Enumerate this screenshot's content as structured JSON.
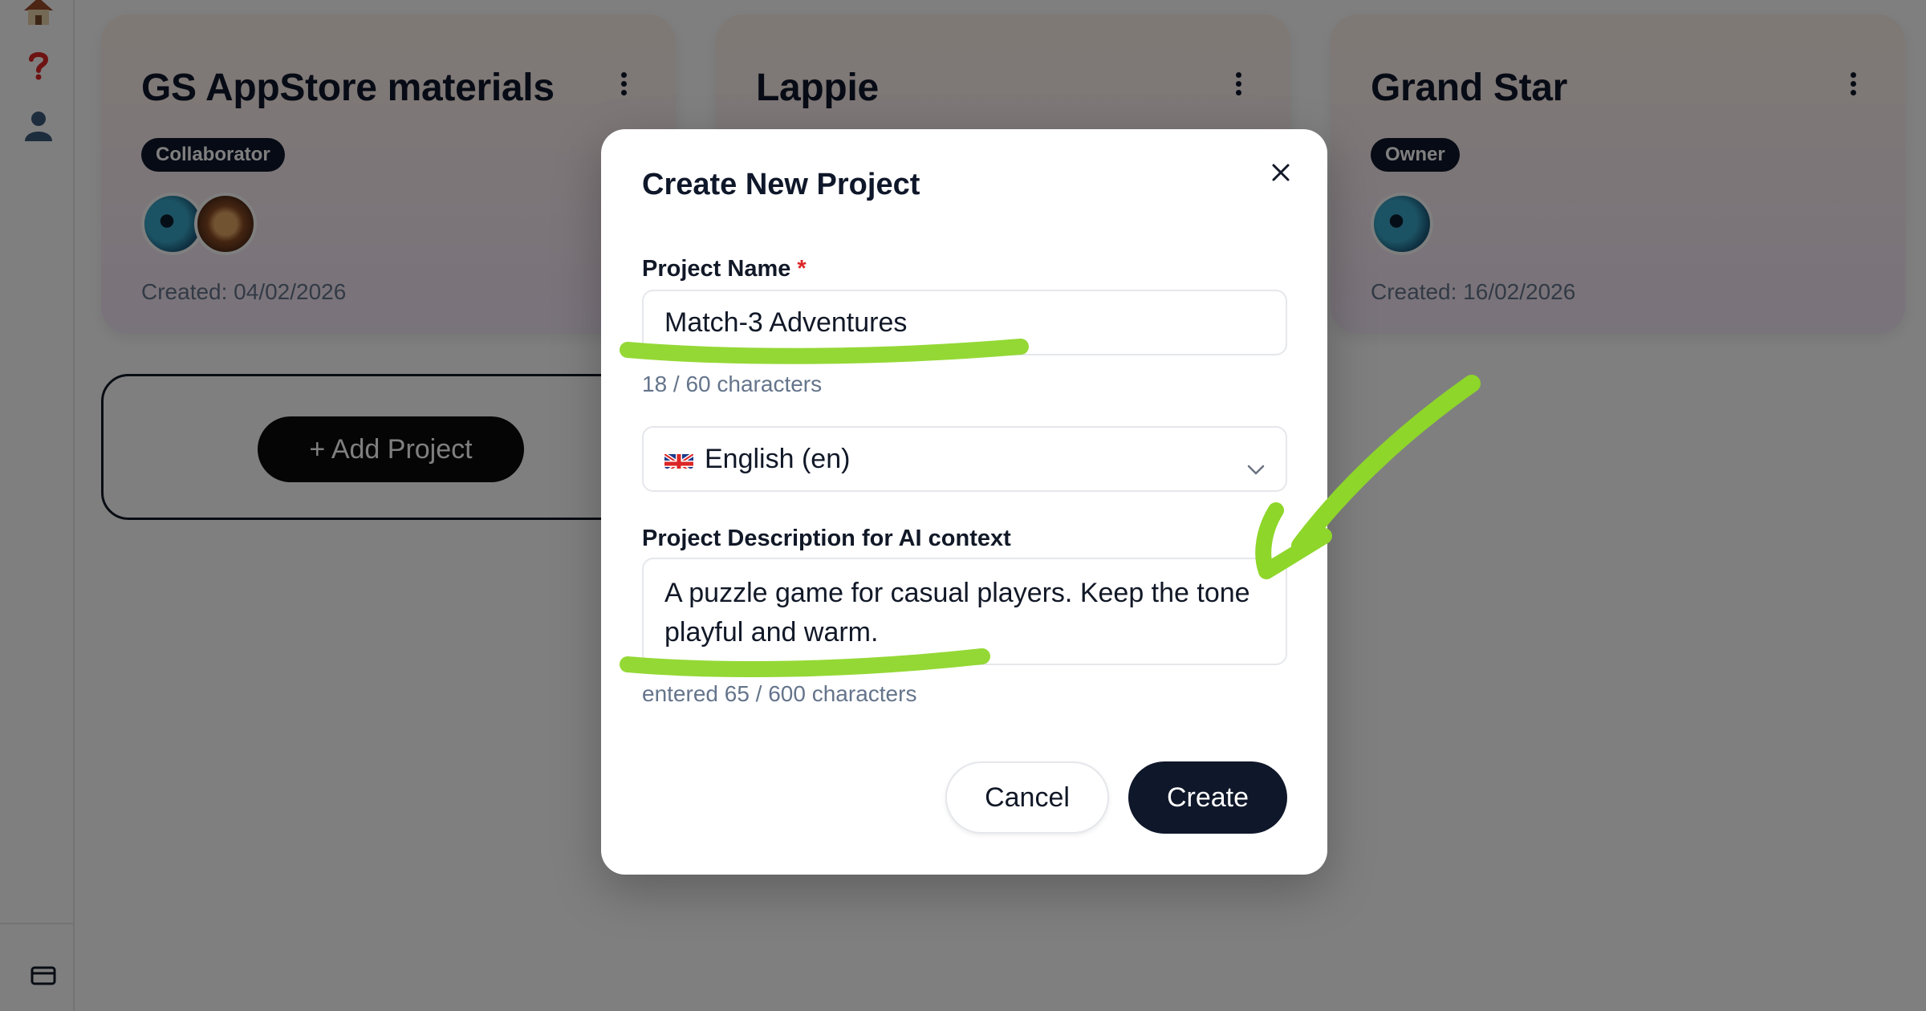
{
  "sidebar": {
    "items": [
      {
        "icon": "house-icon"
      },
      {
        "icon": "help-icon"
      },
      {
        "icon": "user-icon"
      }
    ],
    "bottom_icon": "card-icon"
  },
  "projects": [
    {
      "title": "GS AppStore materials",
      "role": "Collaborator",
      "created": "Created: 04/02/2026",
      "avatars": [
        "eye",
        "lion"
      ]
    },
    {
      "title": "Lappie",
      "role": "",
      "created": "",
      "avatars": []
    },
    {
      "title": "Grand Star",
      "role": "Owner",
      "created": "Created: 16/02/2026",
      "avatars": [
        "eye"
      ]
    }
  ],
  "add_project_label": "+ Add Project",
  "modal": {
    "title": "Create New Project",
    "name_label": "Project Name",
    "required_mark": "*",
    "name_value": "Match-3 Adventures",
    "name_counter": "18 / 60 characters",
    "language_value": "English (en)",
    "description_label": "Project Description for AI context",
    "description_value": "A puzzle game for casual players. Keep the tone playful and warm.",
    "description_counter": "entered 65 / 600 characters",
    "cancel_label": "Cancel",
    "create_label": "Create"
  },
  "colors": {
    "primary_dark": "#0f172a",
    "annotation_green": "#8ed62a",
    "required_red": "#dc2626"
  }
}
